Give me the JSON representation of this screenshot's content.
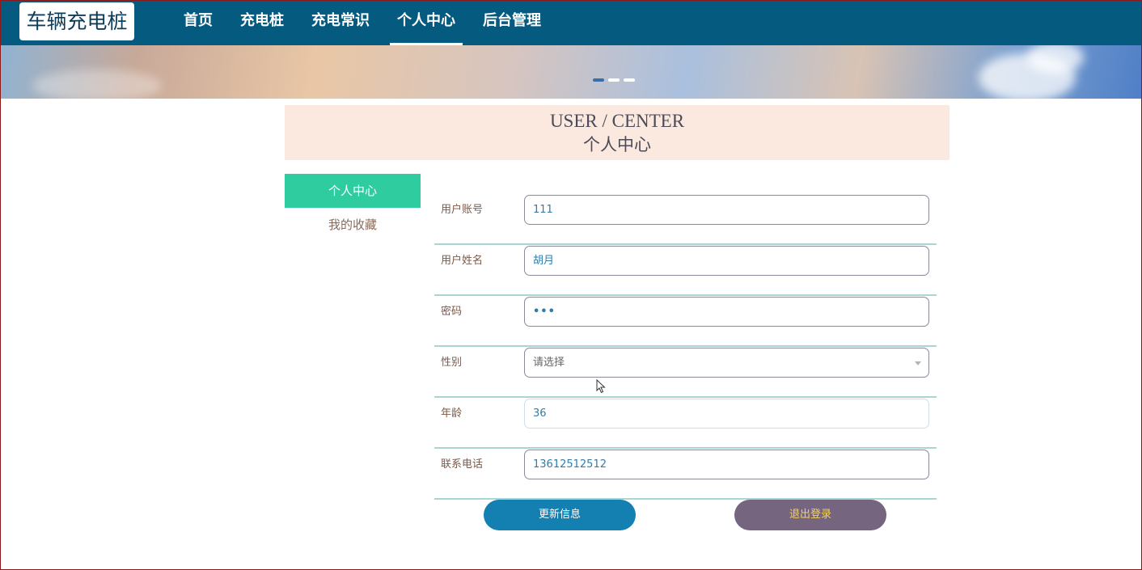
{
  "site": {
    "logo": "车辆充电桩"
  },
  "nav": {
    "items": [
      {
        "label": "首页"
      },
      {
        "label": "充电桩"
      },
      {
        "label": "充电常识"
      },
      {
        "label": "个人中心"
      },
      {
        "label": "后台管理"
      }
    ],
    "active_index": 3
  },
  "banner": {
    "slide_count": 3,
    "active_slide": 0
  },
  "header": {
    "title_en": "USER / CENTER",
    "title_cn": "个人中心"
  },
  "sidebar": {
    "items": [
      {
        "label": "个人中心"
      },
      {
        "label": "我的收藏"
      }
    ]
  },
  "form": {
    "account": {
      "label": "用户账号",
      "value": "111"
    },
    "name": {
      "label": "用户姓名",
      "value": "胡月"
    },
    "password": {
      "label": "密码",
      "value": "•••"
    },
    "gender": {
      "label": "性别",
      "value": "请选择"
    },
    "age": {
      "label": "年龄",
      "value": "36"
    },
    "phone": {
      "label": "联系电话",
      "value": "13612512512"
    }
  },
  "buttons": {
    "update": "更新信息",
    "logout": "退出登录"
  },
  "colors": {
    "nav_bg": "#045a7f",
    "sidebar_active": "#2ecc9f",
    "update_button": "#1480b2",
    "logout_button": "#75657f",
    "logout_text": "#f5d25a",
    "title_box_bg": "#fbe9e0"
  }
}
